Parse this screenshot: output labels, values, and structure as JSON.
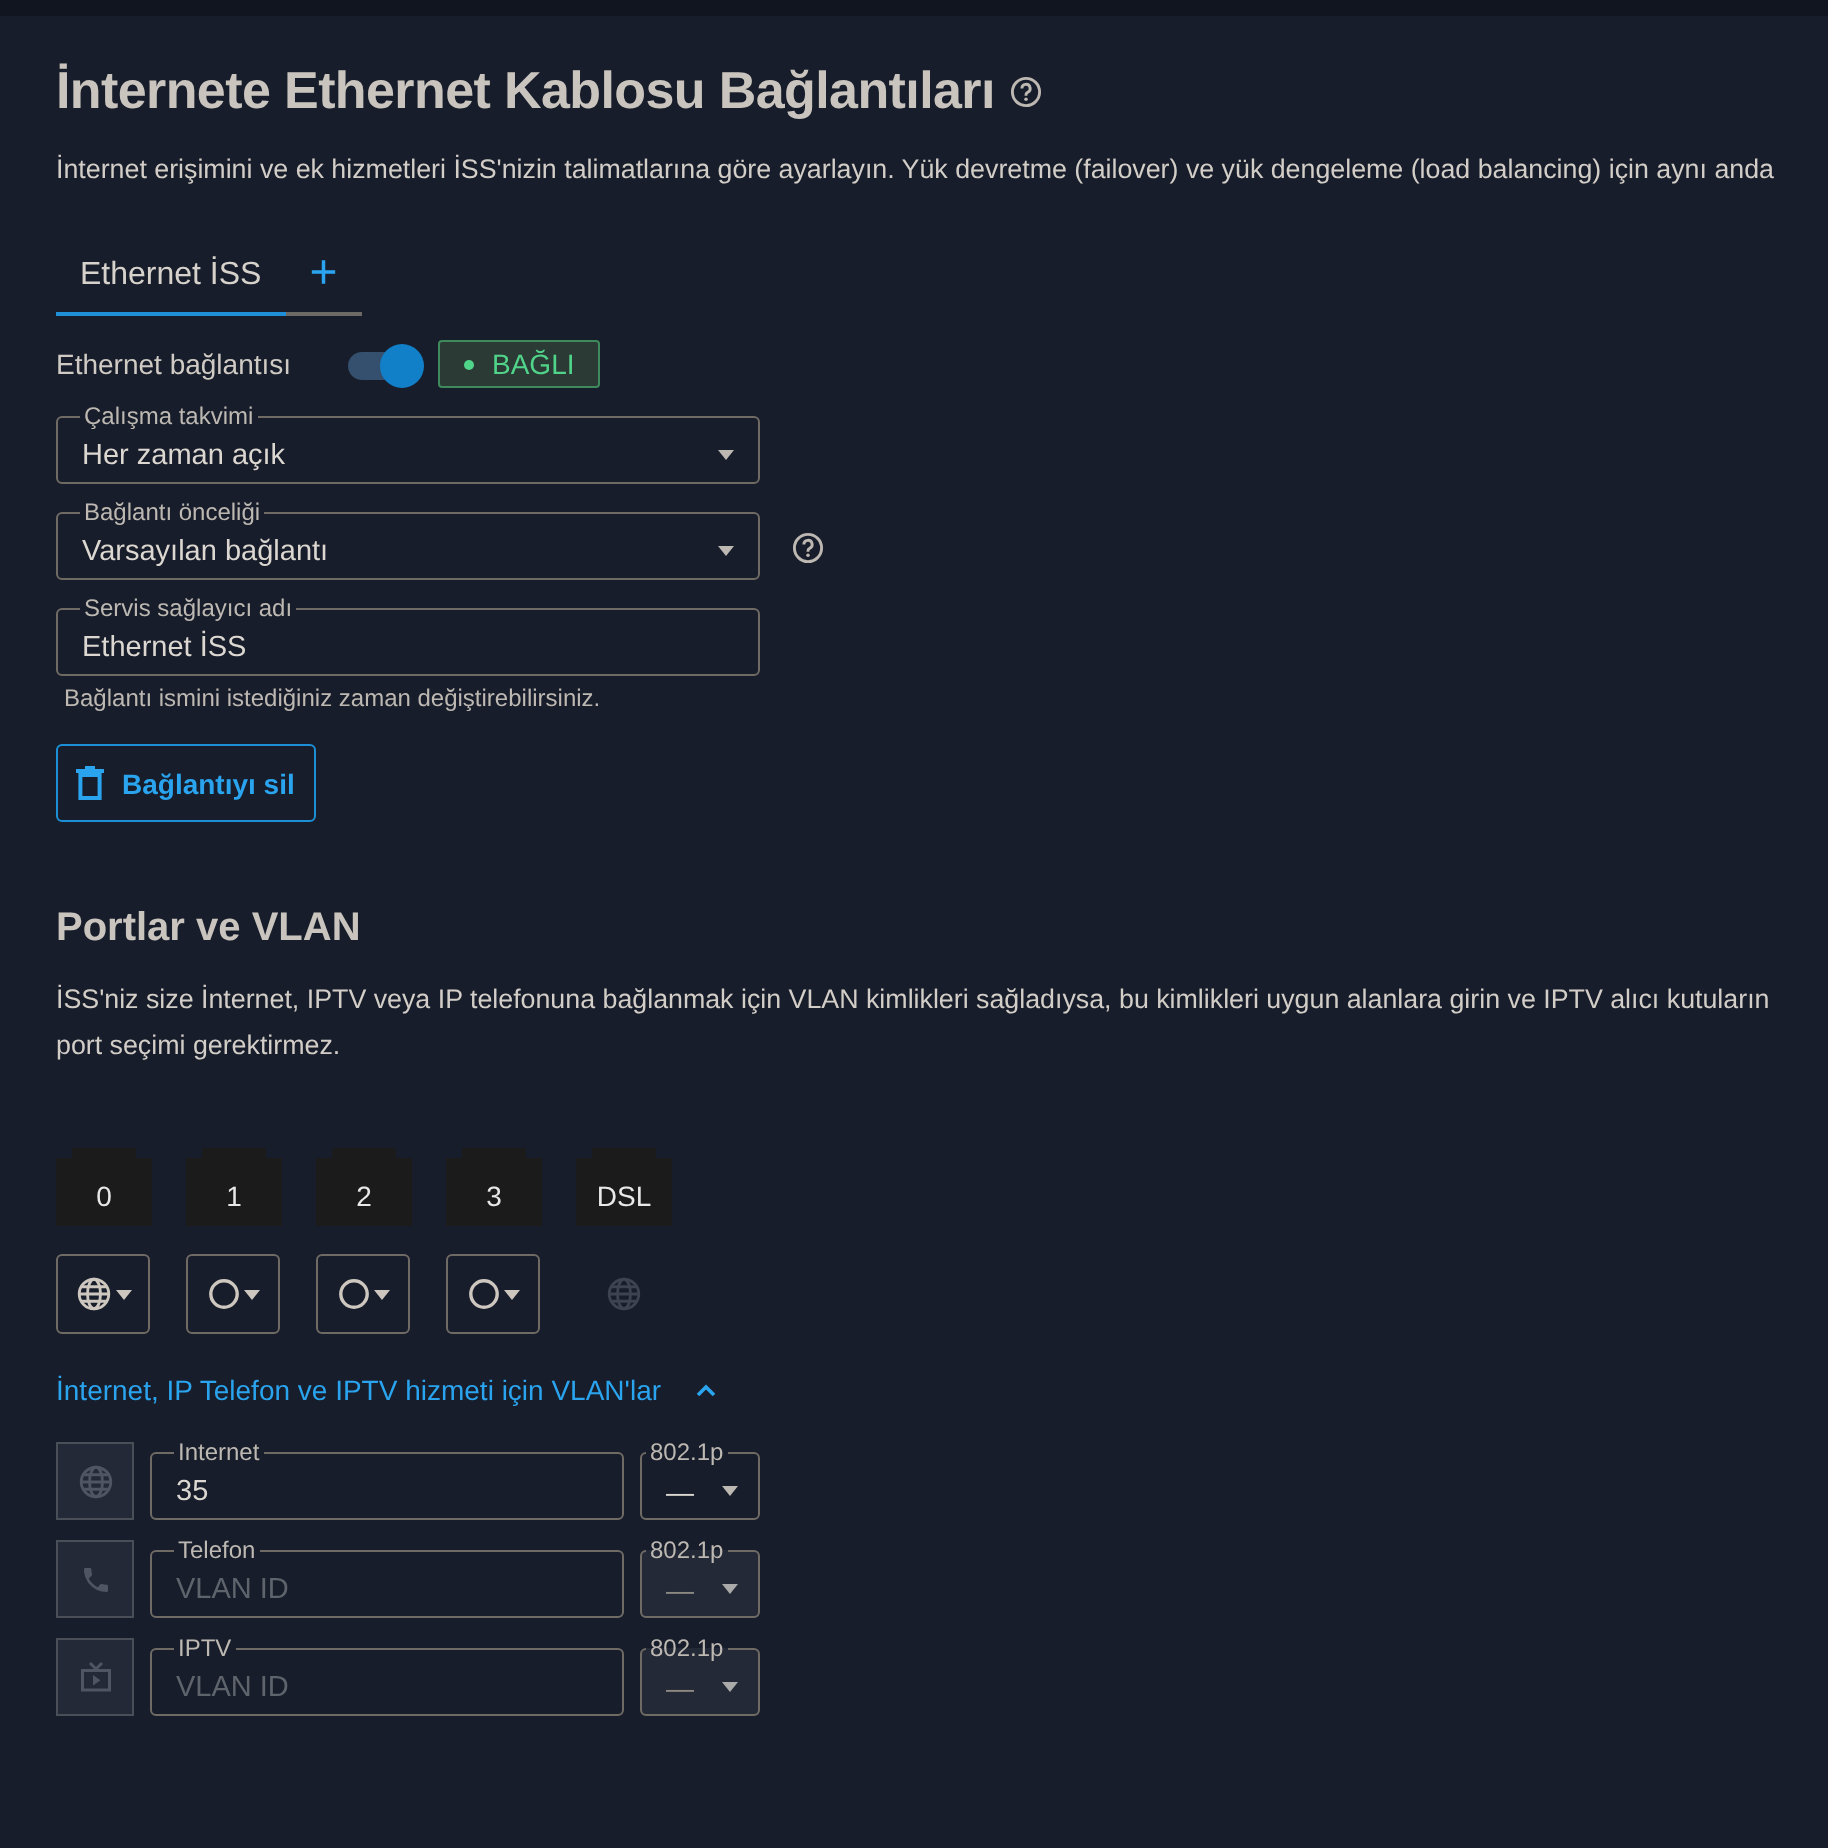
{
  "page": {
    "title": "İnternete Ethernet Kablosu Bağlantıları",
    "description": "İnternet erişimini ve ek hizmetleri İSS'nizin talimatlarına göre ayarlayın. Yük devretme (failover) ve yük dengeleme (load balancing) için aynı anda"
  },
  "tabs": [
    {
      "label": "Ethernet İSS",
      "selected": true
    }
  ],
  "add_tab": "+",
  "connection": {
    "label": "Ethernet bağlantısı",
    "on": true,
    "status": "BAĞLI"
  },
  "fields": [
    {
      "kind": "select",
      "label": "Çalışma takvimi",
      "value": "Her zaman açık",
      "help": false
    },
    {
      "kind": "select",
      "label": "Bağlantı önceliği",
      "value": "Varsayılan bağlantı",
      "help": true
    },
    {
      "kind": "input",
      "label": "Servis sağlayıcı adı",
      "value": "Ethernet İSS",
      "help": false
    }
  ],
  "field_hint": "Bağlantı ismini istediğiniz zaman değiştirebilirsiniz.",
  "delete_button": "Bağlantıyı sil",
  "ports_section": {
    "title": "Portlar ve VLAN",
    "description_lines": [
      "İSS'niz size İnternet, IPTV veya IP telefonuna bağlanmak için VLAN kimlikleri sağladıysa, bu kimlikleri uygun alanlara girin ve IPTV alıcı kutuların",
      "port seçimi gerektirmez."
    ]
  },
  "ports": [
    {
      "label": "0",
      "kind": "globe",
      "disabled": false
    },
    {
      "label": "1",
      "kind": "none",
      "disabled": false
    },
    {
      "label": "2",
      "kind": "none",
      "disabled": false
    },
    {
      "label": "3",
      "kind": "none",
      "disabled": false
    },
    {
      "label": "DSL",
      "kind": "globe",
      "disabled": true
    }
  ],
  "vlan_toggle": {
    "label": "İnternet, IP Telefon ve IPTV hizmeti için VLAN'lar",
    "expanded": true
  },
  "vlans": [
    {
      "kind": "globe",
      "label": "Internet",
      "value": "35",
      "priority_label": "802.1p",
      "priority": "—",
      "disabled": false
    },
    {
      "kind": "phone",
      "label": "Telefon",
      "placeholder": "VLAN ID",
      "priority_label": "802.1p",
      "priority": "—",
      "disabled": true
    },
    {
      "kind": "tv",
      "label": "IPTV",
      "placeholder": "VLAN ID",
      "priority_label": "802.1p",
      "priority": "—",
      "disabled": true
    }
  ]
}
